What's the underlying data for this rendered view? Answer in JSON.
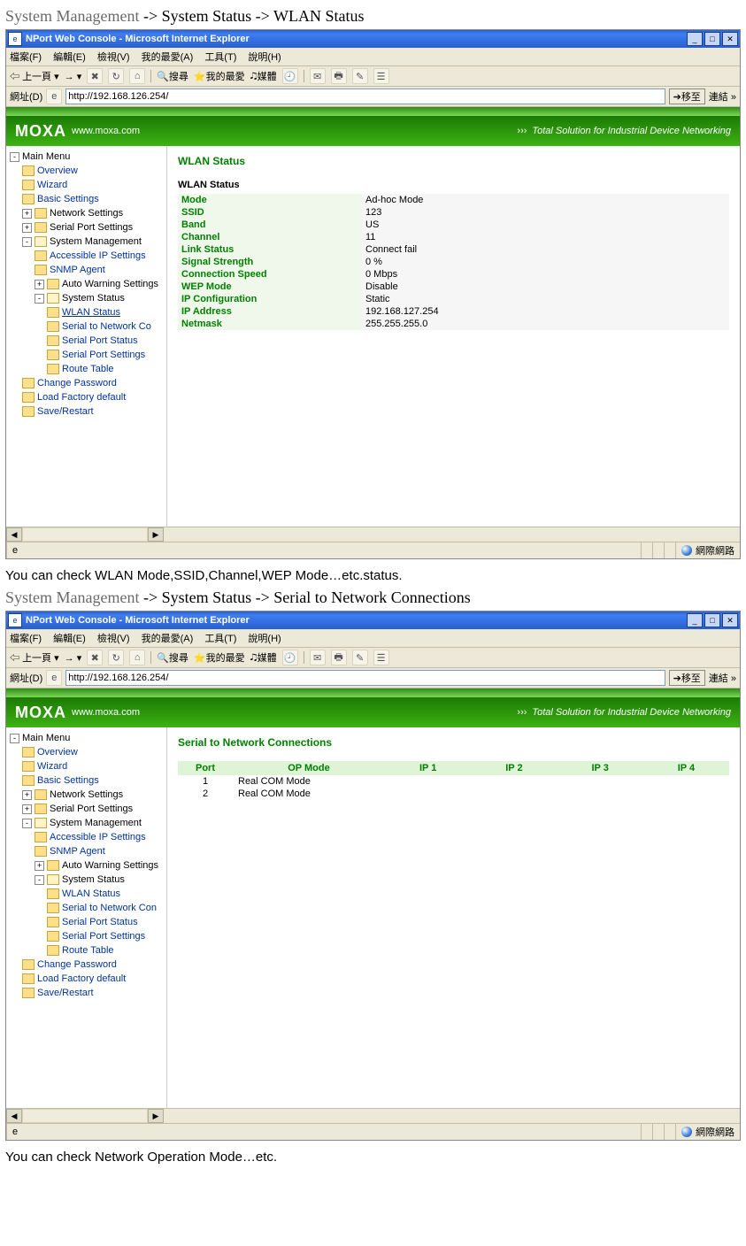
{
  "doc": {
    "line1_sys": "System Management",
    "line1_rest": " ->  System Status -> WLAN Status",
    "caption1": "You can check WLAN Mode,SSID,Channel,WEP Mode…etc.status.",
    "line2_sys": "System Management",
    "line2_rest": " ->  System Status -> Serial to Network Connections",
    "caption2": "You can check Network Operation Mode…etc."
  },
  "browser": {
    "title": "NPort Web Console - Microsoft Internet Explorer",
    "menus": [
      "檔案(F)",
      "編輯(E)",
      "檢視(V)",
      "我的最愛(A)",
      "工具(T)",
      "說明(H)"
    ],
    "back": "上一頁",
    "search": "搜尋",
    "fav": "我的最愛",
    "media": "媒體",
    "addr_label": "網址(D)",
    "url": "http://192.168.126.254/",
    "go": "移至",
    "links": "連結 »",
    "status": "網際網路"
  },
  "brand": {
    "logo": "MOXA",
    "url": "www.moxa.com",
    "tag_prefix": "›››",
    "tag": "Total Solution for Industrial Device Networking"
  },
  "tree": {
    "root": "Main Menu",
    "overview": "Overview",
    "wizard": "Wizard",
    "basic": "Basic Settings",
    "net": "Network Settings",
    "serial": "Serial Port Settings",
    "sysman": "System Management",
    "access": "Accessible IP Settings",
    "snmp": "SNMP Agent",
    "autowarn": "Auto Warning Settings",
    "sysstatus": "System Status",
    "wlan": "WLAN Status",
    "s2n_short": "Serial to Network Co",
    "s2n_full": "Serial to Network Con",
    "sps": "Serial Port Status",
    "spset": "Serial Port Settings",
    "route": "Route Table",
    "chpw": "Change Password",
    "loadf": "Load Factory default",
    "save": "Save/Restart"
  },
  "wlan": {
    "title": "WLAN Status",
    "subtitle": "WLAN Status",
    "rows": [
      {
        "k": "Mode",
        "v": "Ad-hoc Mode"
      },
      {
        "k": "SSID",
        "v": "123"
      },
      {
        "k": "Band",
        "v": "US"
      },
      {
        "k": "Channel",
        "v": "11"
      },
      {
        "k": "Link Status",
        "v": "Connect fail"
      },
      {
        "k": "Signal Strength",
        "v": "0 %"
      },
      {
        "k": "Connection Speed",
        "v": "0 Mbps"
      },
      {
        "k": "WEP Mode",
        "v": "Disable"
      },
      {
        "k": "IP Configuration",
        "v": "Static"
      },
      {
        "k": "IP Address",
        "v": "192.168.127.254"
      },
      {
        "k": "Netmask",
        "v": "255.255.255.0"
      }
    ]
  },
  "s2n": {
    "title": "Serial to Network Connections",
    "headers": [
      "Port",
      "OP Mode",
      "IP 1",
      "IP 2",
      "IP 3",
      "IP 4"
    ],
    "rows": [
      {
        "port": "1",
        "op": "Real COM Mode"
      },
      {
        "port": "2",
        "op": "Real COM Mode"
      }
    ]
  }
}
